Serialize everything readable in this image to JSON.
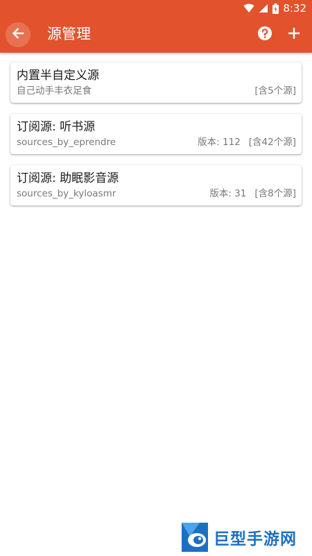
{
  "status_bar": {
    "time": "8:32"
  },
  "toolbar": {
    "title": "源管理",
    "back_icon": "arrow-left-icon",
    "help_icon": "help-circle-icon",
    "add_icon": "plus-icon"
  },
  "colors": {
    "accent": "#e2532d",
    "text_primary": "#1a1a1a",
    "text_secondary": "#777777",
    "watermark_blue": "#1d6fc2"
  },
  "sources": [
    {
      "title": "内置半自定义源",
      "subtitle": "自己动手丰衣足食",
      "version": "",
      "count": "[含5个源]"
    },
    {
      "title": "订阅源: 听书源",
      "subtitle": "sources_by_eprendre",
      "version": "版本: 112",
      "count": "[含42个源]"
    },
    {
      "title": "订阅源: 助眠影音源",
      "subtitle": "sources_by_kyloasmr",
      "version": "版本: 31",
      "count": "[含8个源]"
    }
  ],
  "watermark": {
    "text": "巨型手游网"
  }
}
